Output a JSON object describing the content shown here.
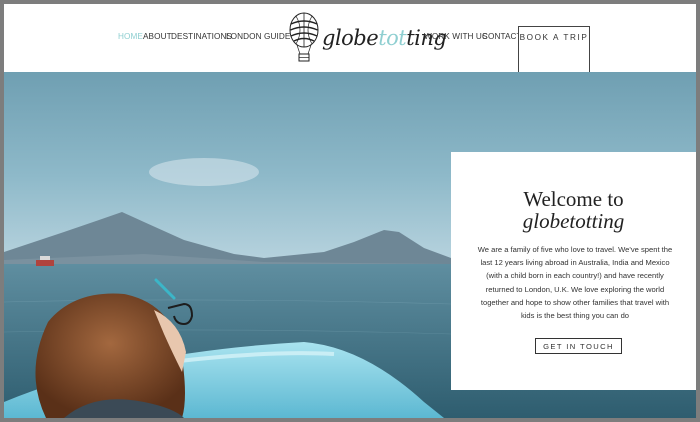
{
  "nav": {
    "home": "HOME",
    "about": "ABOUT",
    "destinations": "DESTINATIONS",
    "london_guide": "LONDON GUIDE",
    "work_with_us": "WORK WITH US",
    "contact": "CONTACT",
    "book_a_trip": "BOOK A TRIP"
  },
  "logo": {
    "prefix": "globe",
    "accent": "tot",
    "suffix": "ting",
    "icon": "hot-air-balloon-icon"
  },
  "welcome": {
    "title": "Welcome to",
    "subtitle": "globetotting",
    "body": "We are a family of five who love to travel. We've spent the last 12 years living abroad in Australia, India and Mexico (with a child born in each country!) and have recently returned to London, U.K. We love exploring the world together and hope to show other families that travel with kids is the best thing you can do",
    "cta": "GET IN TOUCH"
  },
  "colors": {
    "accent": "#8fcfd1",
    "text": "#333333",
    "frame": "#7d7d7d"
  }
}
